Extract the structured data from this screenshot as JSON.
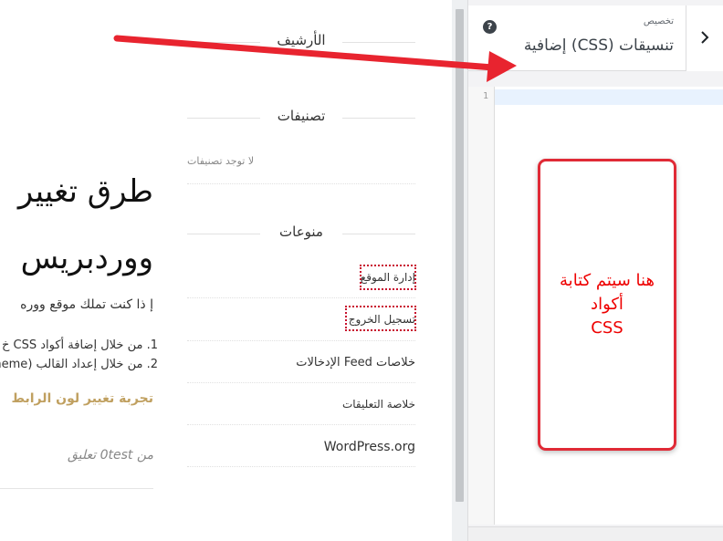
{
  "preview": {
    "post_title_line1": "طرق تغيير",
    "post_title_line2": "ووردبريس",
    "post_intro": "إ ذا كنت تملك موقع ووره",
    "post_list": [
      "1. من خلال إضافة أكواد CSS خ",
      "2. من خلال إعداد القالب (heme"
    ],
    "post_link": "تجربة تغيير لون الرابط",
    "post_meta": "من 0test تعليق",
    "widgets": {
      "archives_title": "الأرشيف",
      "categories_title": "تصنيفات",
      "no_categories": "لا توجد تصنيفات",
      "misc_title": "منوعات",
      "misc_items": [
        "إدارة الموقع",
        "تسجيل الخروج",
        "خلاصات Feed الإدخالات",
        "خلاصة التعليقات",
        "WordPress.org"
      ]
    }
  },
  "panel": {
    "subtitle": "تخصيص",
    "title": "تنسيقات (CSS) إضافية",
    "help_icon": "question-circle-icon",
    "back_icon": "chevron-right-icon",
    "help_glyph": "?",
    "line_number": "1"
  },
  "annotation": {
    "lines": [
      "هنا سيتم كتابة",
      "أكواد",
      "CSS"
    ],
    "color": "#e02a36"
  }
}
